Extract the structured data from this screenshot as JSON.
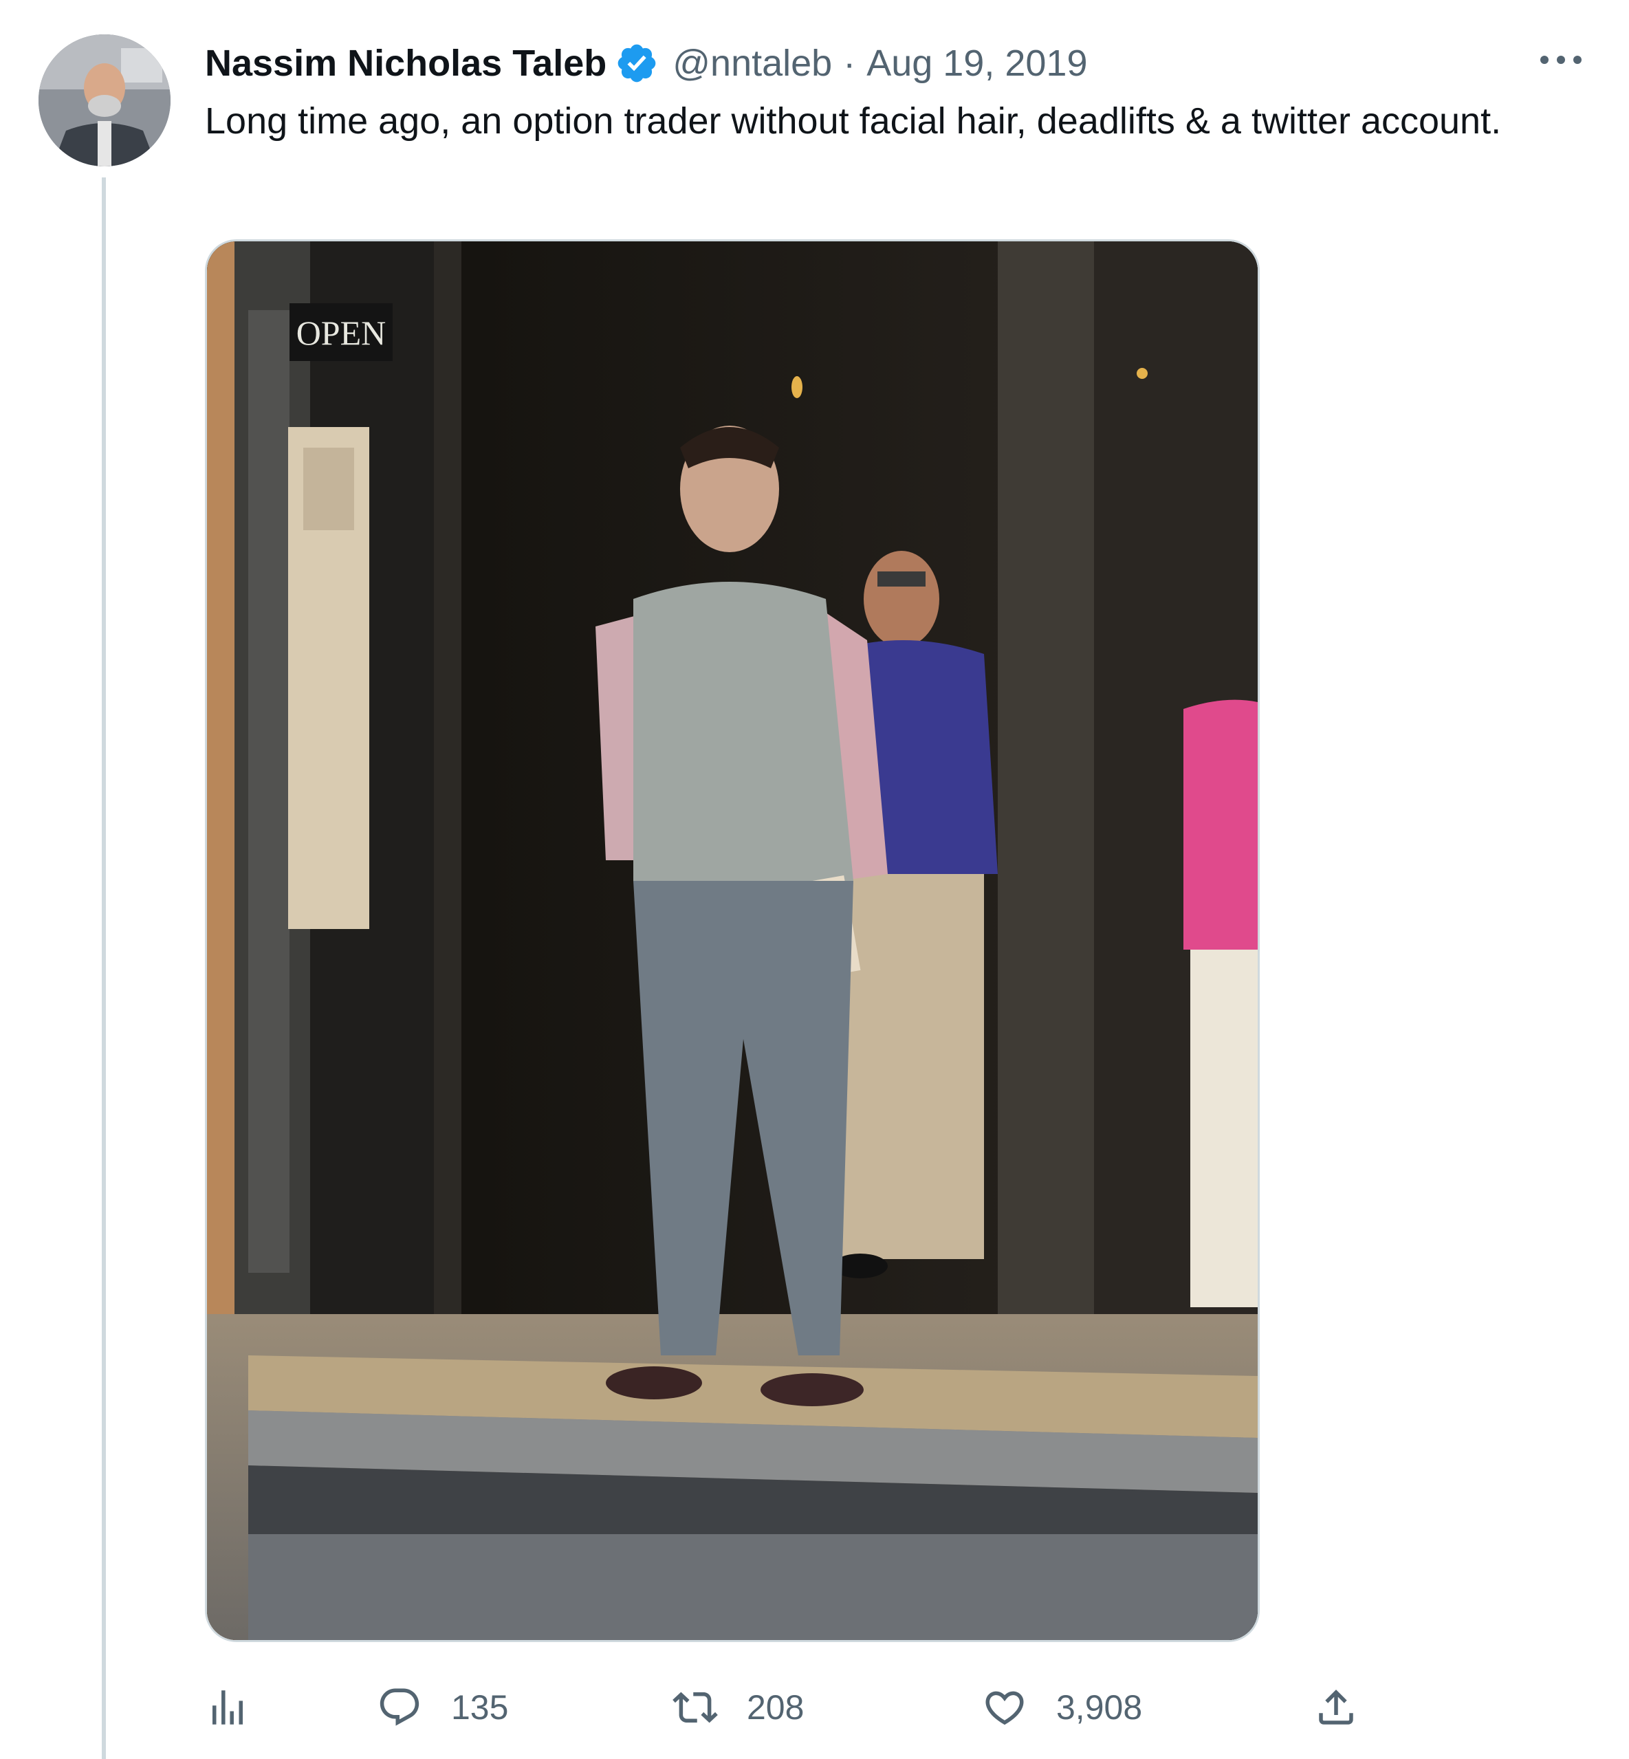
{
  "tweet": {
    "author_name": "Nassim Nicholas Taleb",
    "handle": "@nntaleb",
    "separator": "·",
    "date": "Aug 19, 2019",
    "text": "Long time ago, an option trader without facial hair, deadlifts & a twitter account.",
    "verified": true,
    "media": {
      "sign_text": "OPEN"
    }
  },
  "actions": {
    "analytics": {
      "icon": "analytics-icon"
    },
    "reply": {
      "icon": "reply-icon",
      "count": "135"
    },
    "retweet": {
      "icon": "retweet-icon",
      "count": "208"
    },
    "like": {
      "icon": "heart-icon",
      "count": "3,908"
    },
    "share": {
      "icon": "share-icon"
    }
  },
  "colors": {
    "text_primary": "#0f1419",
    "text_secondary": "#536471",
    "verified_blue": "#1d9bf0",
    "border": "#cfd9de"
  }
}
